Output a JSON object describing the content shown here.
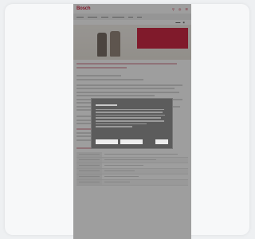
{
  "header": {
    "logo": "Bosch",
    "icons": [
      "search-icon",
      "globe-icon",
      "menu-icon"
    ]
  },
  "nav": {
    "items": [
      "",
      "",
      "",
      "",
      "",
      ""
    ]
  },
  "hero": {
    "box_title": "",
    "box_lines": [
      "",
      "",
      ""
    ],
    "link": ""
  },
  "main": {
    "title": "",
    "subtitle": "",
    "section_heading": "",
    "section2_heading": ""
  },
  "table": {
    "rows": 6
  },
  "cookie_modal": {
    "title": "",
    "buttons": [
      "",
      "",
      ""
    ]
  },
  "colors": {
    "accent": "#c8102e",
    "overlay": "#282828",
    "modal_bg": "#5c5c5c"
  }
}
